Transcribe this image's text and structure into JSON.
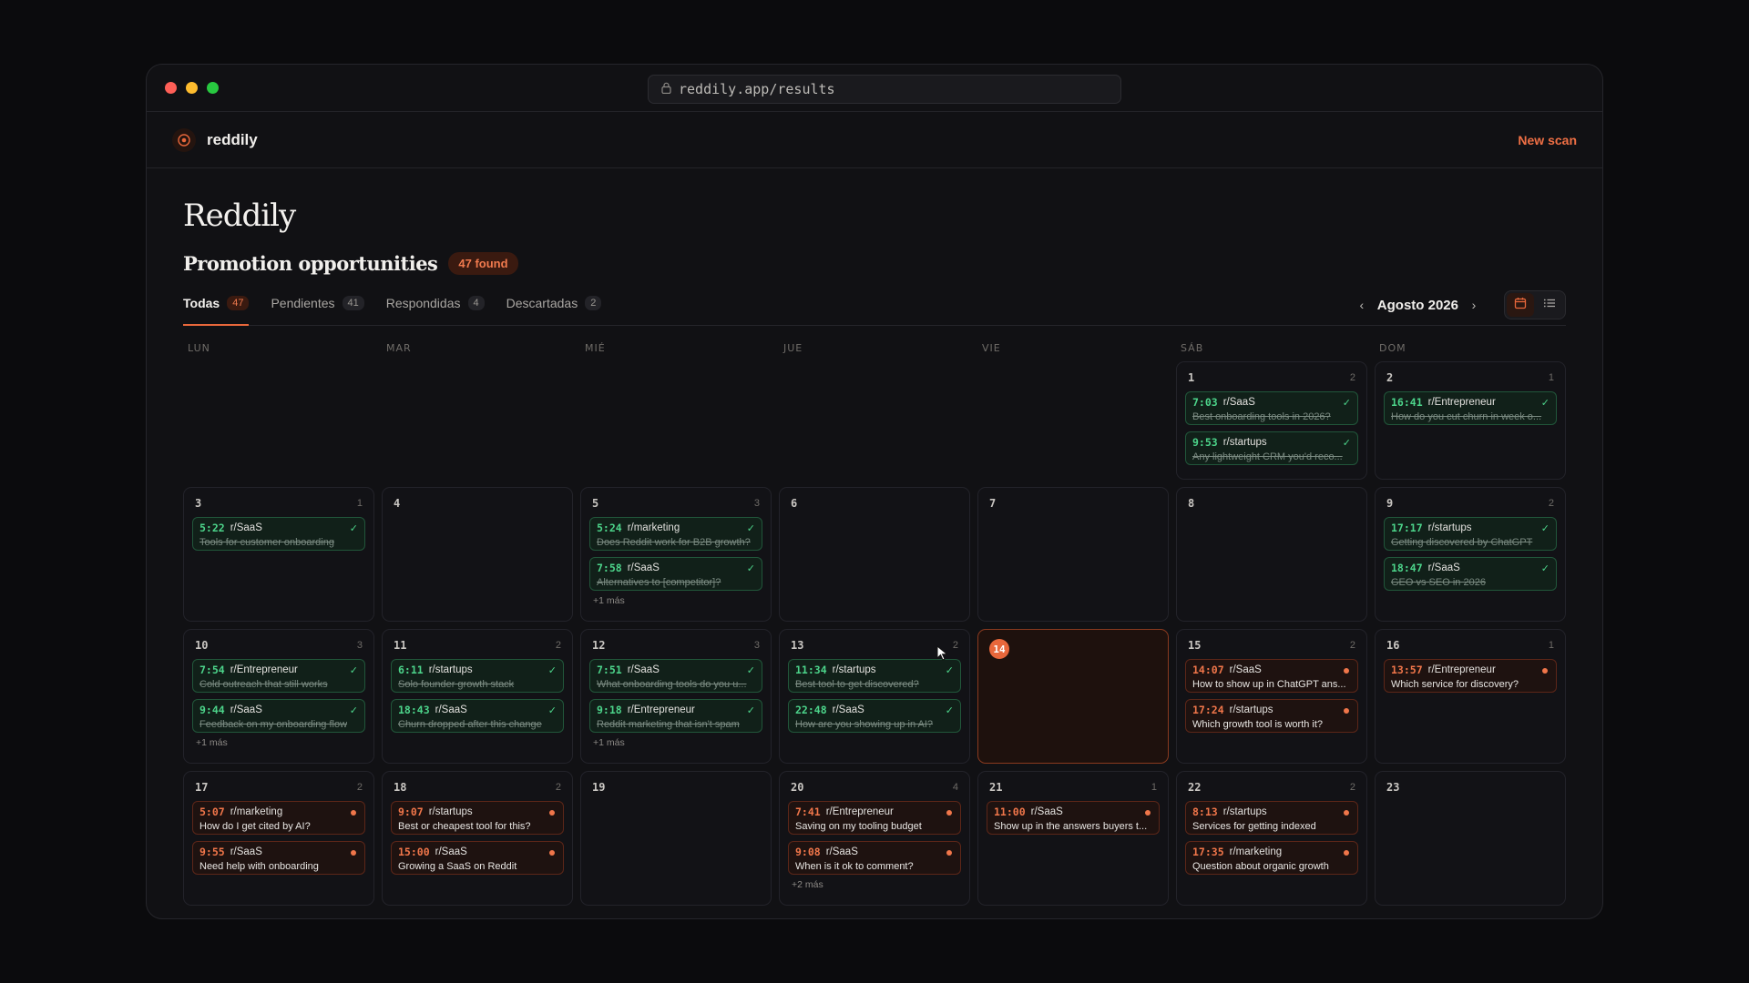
{
  "browser": {
    "url": "reddily.app/results"
  },
  "app": {
    "brand": "reddily",
    "new_scan": "New scan"
  },
  "page": {
    "title": "Reddily",
    "subtitle": "Promotion opportunities",
    "found_badge": "47 found"
  },
  "tabs": [
    {
      "label": "Todas",
      "count": "47",
      "active": true
    },
    {
      "label": "Pendientes",
      "count": "41"
    },
    {
      "label": "Respondidas",
      "count": "4"
    },
    {
      "label": "Descartadas",
      "count": "2"
    }
  ],
  "calendar": {
    "month": "Agosto 2026",
    "weekdays": [
      "LUN",
      "MAR",
      "MIÉ",
      "JUE",
      "VIE",
      "SÁB",
      "DOM"
    ],
    "days": [
      {
        "empty": true
      },
      {
        "empty": true
      },
      {
        "empty": true
      },
      {
        "empty": true
      },
      {
        "empty": true
      },
      {
        "day": "1",
        "count": "2",
        "events": [
          {
            "time": "7:03",
            "sub": "r/SaaS",
            "title": "Best onboarding tools in 2026?",
            "status": "done"
          },
          {
            "time": "9:53",
            "sub": "r/startups",
            "title": "Any lightweight CRM you'd reco...",
            "status": "done"
          }
        ]
      },
      {
        "day": "2",
        "count": "1",
        "events": [
          {
            "time": "16:41",
            "sub": "r/Entrepreneur",
            "title": "How do you cut churn in week o...",
            "status": "done"
          }
        ]
      },
      {
        "day": "3",
        "count": "1",
        "events": [
          {
            "time": "5:22",
            "sub": "r/SaaS",
            "title": "Tools for customer onboarding",
            "status": "done"
          }
        ]
      },
      {
        "day": "4",
        "count": "",
        "events": []
      },
      {
        "day": "5",
        "count": "3",
        "more": "+1 más",
        "events": [
          {
            "time": "5:24",
            "sub": "r/marketing",
            "title": "Does Reddit work for B2B growth?",
            "status": "done"
          },
          {
            "time": "7:58",
            "sub": "r/SaaS",
            "title": "Alternatives to [competitor]?",
            "status": "done"
          }
        ]
      },
      {
        "day": "6",
        "count": "",
        "events": []
      },
      {
        "day": "7",
        "count": "",
        "events": []
      },
      {
        "day": "8",
        "count": "",
        "events": []
      },
      {
        "day": "9",
        "count": "2",
        "events": [
          {
            "time": "17:17",
            "sub": "r/startups",
            "title": "Getting discovered by ChatGPT",
            "status": "done"
          },
          {
            "time": "18:47",
            "sub": "r/SaaS",
            "title": "GEO vs SEO in 2026",
            "status": "done"
          }
        ]
      },
      {
        "day": "10",
        "count": "3",
        "more": "+1 más",
        "events": [
          {
            "time": "7:54",
            "sub": "r/Entrepreneur",
            "title": "Cold outreach that still works",
            "status": "done"
          },
          {
            "time": "9:44",
            "sub": "r/SaaS",
            "title": "Feedback on my onboarding flow",
            "status": "done"
          }
        ]
      },
      {
        "day": "11",
        "count": "2",
        "events": [
          {
            "time": "6:11",
            "sub": "r/startups",
            "title": "Solo founder growth stack",
            "status": "done"
          },
          {
            "time": "18:43",
            "sub": "r/SaaS",
            "title": "Churn dropped after this change",
            "status": "done"
          }
        ]
      },
      {
        "day": "12",
        "count": "3",
        "more": "+1 más",
        "events": [
          {
            "time": "7:51",
            "sub": "r/SaaS",
            "title": "What onboarding tools do you u...",
            "status": "done"
          },
          {
            "time": "9:18",
            "sub": "r/Entrepreneur",
            "title": "Reddit marketing that isn't spam",
            "status": "done"
          }
        ]
      },
      {
        "day": "13",
        "count": "2",
        "events": [
          {
            "time": "11:34",
            "sub": "r/startups",
            "title": "Best tool to get discovered?",
            "status": "done"
          },
          {
            "time": "22:48",
            "sub": "r/SaaS",
            "title": "How are you showing up in AI?",
            "status": "done"
          }
        ]
      },
      {
        "day": "14",
        "count": "",
        "today": true,
        "events": []
      },
      {
        "day": "15",
        "count": "2",
        "events": [
          {
            "time": "14:07",
            "sub": "r/SaaS",
            "title": "How to show up in ChatGPT ans...",
            "status": "pend"
          },
          {
            "time": "17:24",
            "sub": "r/startups",
            "title": "Which growth tool is worth it?",
            "status": "pend"
          }
        ]
      },
      {
        "day": "16",
        "count": "1",
        "events": [
          {
            "time": "13:57",
            "sub": "r/Entrepreneur",
            "title": "Which service for discovery?",
            "status": "pend"
          }
        ]
      },
      {
        "day": "17",
        "count": "2",
        "events": [
          {
            "time": "5:07",
            "sub": "r/marketing",
            "title": "How do I get cited by AI?",
            "status": "pend"
          },
          {
            "time": "9:55",
            "sub": "r/SaaS",
            "title": "Need help with onboarding",
            "status": "pend"
          }
        ]
      },
      {
        "day": "18",
        "count": "2",
        "events": [
          {
            "time": "9:07",
            "sub": "r/startups",
            "title": "Best or cheapest tool for this?",
            "status": "pend"
          },
          {
            "time": "15:00",
            "sub": "r/SaaS",
            "title": "Growing a SaaS on Reddit",
            "status": "pend"
          }
        ]
      },
      {
        "day": "19",
        "count": "",
        "events": []
      },
      {
        "day": "20",
        "count": "4",
        "more": "+2 más",
        "events": [
          {
            "time": "7:41",
            "sub": "r/Entrepreneur",
            "title": "Saving on my tooling budget",
            "status": "pend"
          },
          {
            "time": "9:08",
            "sub": "r/SaaS",
            "title": "When is it ok to comment?",
            "status": "pend"
          }
        ]
      },
      {
        "day": "21",
        "count": "1",
        "events": [
          {
            "time": "11:00",
            "sub": "r/SaaS",
            "title": "Show up in the answers buyers t...",
            "status": "pend"
          }
        ]
      },
      {
        "day": "22",
        "count": "2",
        "events": [
          {
            "time": "8:13",
            "sub": "r/startups",
            "title": "Services for getting indexed",
            "status": "pend"
          },
          {
            "time": "17:35",
            "sub": "r/marketing",
            "title": "Question about organic growth",
            "status": "pend"
          }
        ]
      },
      {
        "day": "23",
        "count": "",
        "events": []
      }
    ]
  },
  "icons": {
    "lock": "lock-icon",
    "logo": "target-icon",
    "prev": "chevron-left-icon",
    "next": "chevron-right-icon",
    "calendar_view": "calendar-icon",
    "list_view": "list-icon"
  },
  "colors": {
    "accent": "#e8673b",
    "done": "#4cd48a",
    "pending": "#f0764a",
    "bg": "#111114"
  }
}
